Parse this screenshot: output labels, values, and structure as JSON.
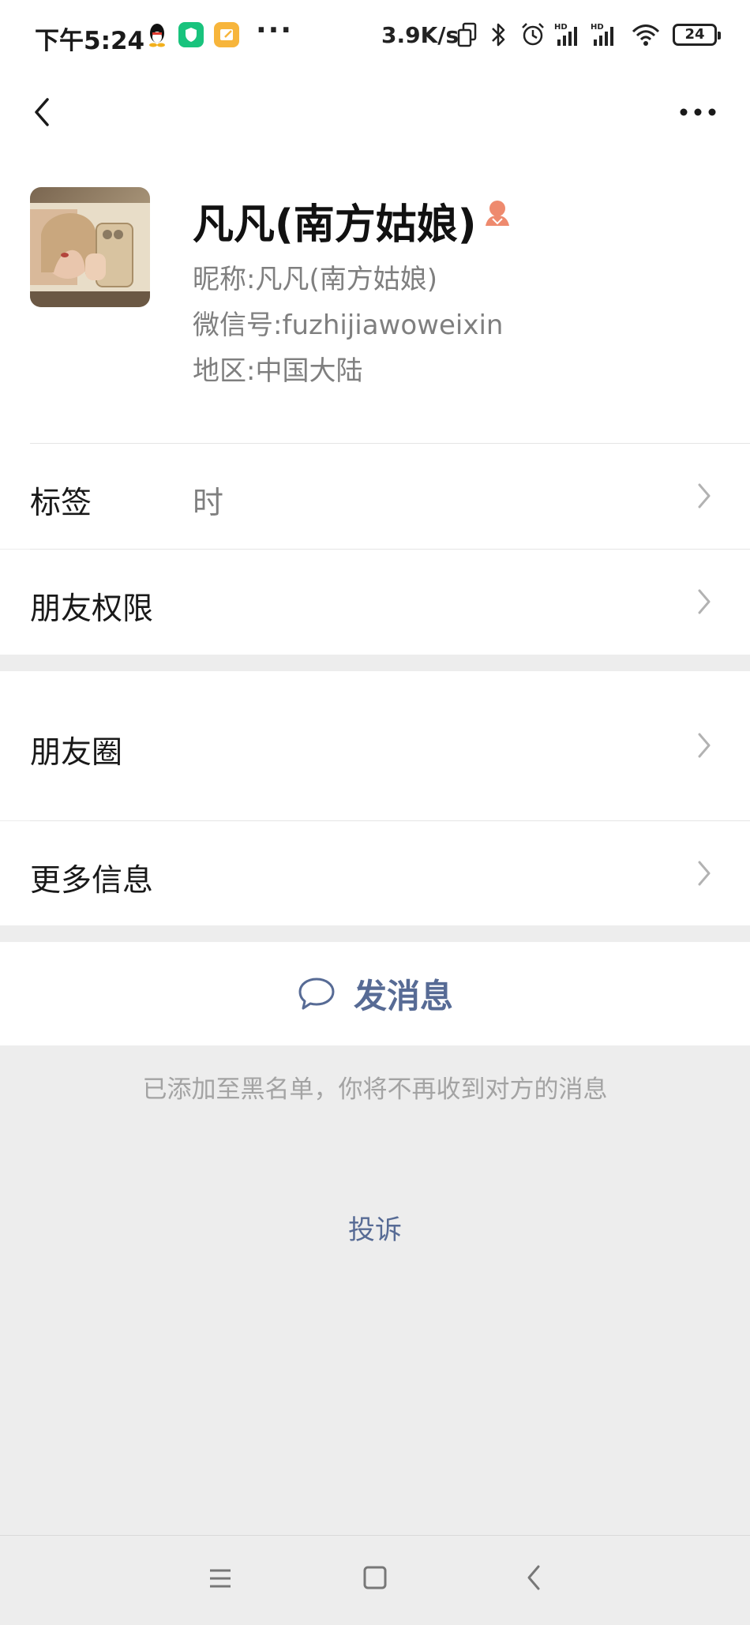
{
  "status_bar": {
    "time": "下午5:24",
    "network_speed": "3.9K/s",
    "battery": "24",
    "icons": [
      "qq-icon",
      "shield-app-icon",
      "notes-app-icon",
      "more-notifications-icon",
      "dual-sim-icon",
      "bluetooth-icon",
      "alarm-icon",
      "signal-hd-1-icon",
      "signal-hd-2-icon",
      "wifi-icon",
      "battery-icon"
    ]
  },
  "nav": {
    "back_icon": "chevron-left-icon",
    "more_icon": "more-horizontal-icon"
  },
  "profile": {
    "display_name": "凡凡(南方姑娘)",
    "gender_icon": "female-icon",
    "nickname_label": "昵称:",
    "nickname": "凡凡(南方姑娘)",
    "wechat_id_label": "微信号:",
    "wechat_id": "fuzhijiawoweixin",
    "region_label": "地区:",
    "region": "中国大陆"
  },
  "rows": {
    "tags_label": "标签",
    "tags_value": "时",
    "friend_permissions_label": "朋友权限",
    "moments_label": "朋友圈",
    "more_info_label": "更多信息"
  },
  "actions": {
    "send_message_label": "发消息"
  },
  "notice": {
    "blocked_text": "已添加至黑名单，你将不再收到对方的消息",
    "report_label": "投诉"
  },
  "colors": {
    "link_blue": "#576b95",
    "gender_orange": "#ee8a6e",
    "background_gray": "#ededed"
  }
}
